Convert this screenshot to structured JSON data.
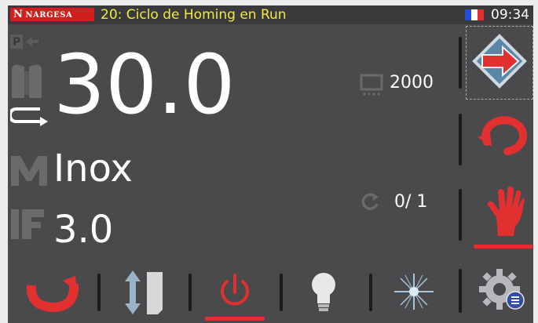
{
  "header": {
    "brand": "NARGESA",
    "title": "20: Ciclo de Homing en Run",
    "time": "09:34",
    "flag_colors": [
      "#1f4fd8",
      "#ffffff",
      "#e0302f"
    ]
  },
  "main": {
    "bend_angle": "30.0",
    "material": "Inox",
    "thickness": "3.0",
    "count_value": "2000",
    "cycle_counter": "0/ 1"
  },
  "icons": {
    "program": "program-indicator-icon",
    "angle": "angle-icon",
    "material": "material-icon",
    "thickness": "thickness-icon",
    "count": "counter-display-icon",
    "cycle": "cycle-refresh-icon"
  },
  "sidebar": {
    "items": [
      "next-arrow-button",
      "cycle-mode-button",
      "manual-mode-button"
    ],
    "active": "manual-mode-button"
  },
  "toolbar": {
    "items": [
      "rotate-button",
      "vertical-move-button",
      "power-button",
      "light-button",
      "laser-button",
      "settings-button"
    ],
    "active": "power-button"
  },
  "colors": {
    "accent_red": "#e0302f",
    "title_yellow": "#f2ea3e",
    "background": "#4a4a4d"
  }
}
